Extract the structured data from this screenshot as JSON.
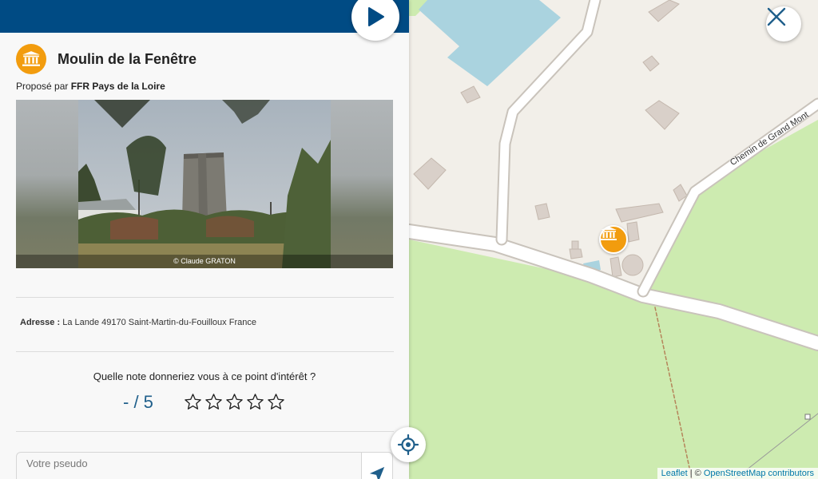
{
  "poi": {
    "title": "Moulin de la Fenêtre",
    "proposed_prefix": "Proposé par",
    "proposed_by": "FFR Pays de la Loire",
    "photo_credit": "© Claude GRATON",
    "address_label": "Adresse :",
    "address_value": "La Lande 49170 Saint-Martin-du-Fouilloux France",
    "icon": "museum-icon"
  },
  "rating": {
    "question": "Quelle note donneriez vous à ce point d'intérêt ?",
    "score_display": "- / 5",
    "stars_count": 5,
    "stars_selected": 0
  },
  "comment": {
    "pseudo_placeholder": "Votre pseudo"
  },
  "map": {
    "road_label": "Chemin de Grand Mont",
    "attribution_leaflet": "Leaflet",
    "attribution_sep": " | © ",
    "attribution_osm": "OpenStreetMap contributors"
  },
  "colors": {
    "header": "#004b84",
    "accent_orange": "#f29c0e",
    "score_blue": "#1f5f8b"
  }
}
